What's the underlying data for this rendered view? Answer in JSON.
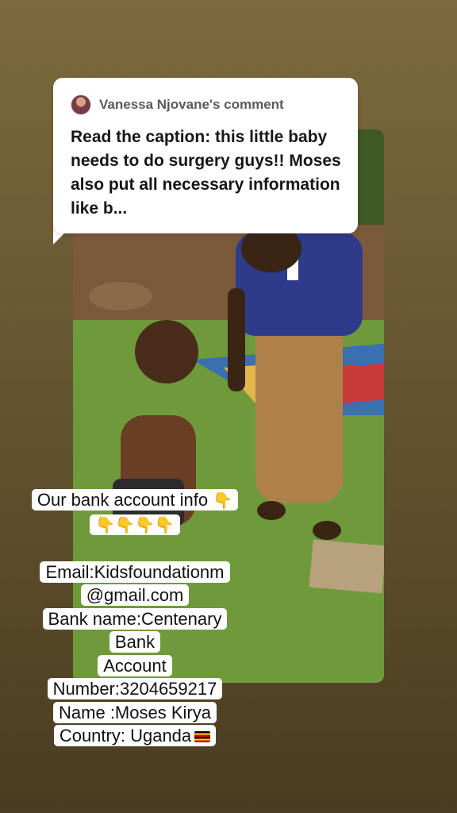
{
  "comment": {
    "author": "Vanessa Njovane's comment",
    "text": "Read the caption: this little baby needs to do surgery guys!! Moses also put all necessary information like b..."
  },
  "caption": {
    "line1": "Our bank account info",
    "line1_emoji": "👇",
    "line2_emoji": "👇👇👇👇",
    "email_line1": "Email:Kidsfoundationm",
    "email_line2": "@gmail.com",
    "bank_line1": "Bank name:Centenary",
    "bank_line2": "Bank",
    "account_line1": "Account",
    "account_line2": "Number:3204659217",
    "name_line": "Name :Moses Kirya",
    "country_line": "Country: Uganda"
  },
  "colors": {
    "background": "#6b5a33",
    "card": "#ffffff",
    "text": "#111111"
  }
}
